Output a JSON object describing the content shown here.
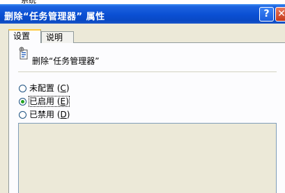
{
  "background": {
    "partial_text": "系统"
  },
  "window": {
    "title": "删除“任务管理器” 属性",
    "help_label": "?",
    "close_label": "✕"
  },
  "tabs": [
    {
      "label": "设置",
      "active": true
    },
    {
      "label": "说明",
      "active": false
    }
  ],
  "policy": {
    "name": "删除“任务管理器”",
    "icon": "policy-setting-icon"
  },
  "options": [
    {
      "label": "未配置",
      "accel": "C",
      "selected": false
    },
    {
      "label": "已启用",
      "accel": "E",
      "selected": true
    },
    {
      "label": "已禁用",
      "accel": "D",
      "selected": false
    }
  ],
  "colors": {
    "titlebar": "#0a4fd3",
    "dialog_bg": "#ece9d8",
    "radio_dot": "#21a121",
    "tab_highlight": "#ffc83c"
  }
}
